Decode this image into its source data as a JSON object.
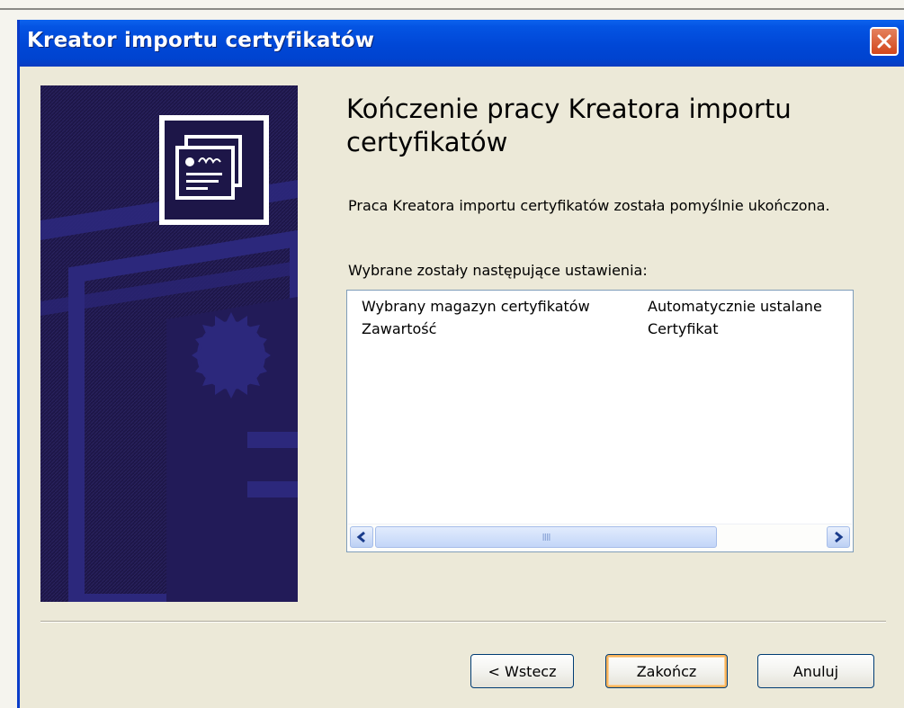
{
  "window": {
    "title": "Kreator importu certyfikatów",
    "close_label": "Close"
  },
  "main": {
    "heading": "Kończenie pracy Kreatora importu certyfikatów",
    "intro": "Praca Kreatora importu certyfikatów została pomyślnie ukończona.",
    "settings_label": "Wybrane zostały następujące ustawienia:",
    "settings": [
      {
        "name": "Wybrany magazyn certyfikatów",
        "value": "Automatycznie ustalane"
      },
      {
        "name": "Zawartość",
        "value": "Certyfikat"
      }
    ],
    "scrollbar_grip": "IIII"
  },
  "buttons": {
    "back": "< Wstecz",
    "finish": "Zakończ",
    "cancel": "Anuluj"
  },
  "colors": {
    "titlebar": "#0047d6",
    "side_panel": "#1d1648",
    "dialog_bg": "#ece9d8",
    "close_button": "#d2461c"
  }
}
